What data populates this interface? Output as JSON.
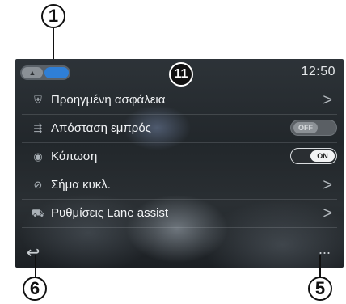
{
  "callouts": {
    "toggle": "1",
    "back": "6",
    "more": "5",
    "screen_marker": "11"
  },
  "status_bar": {
    "clock": "12:50"
  },
  "menu": {
    "items": [
      {
        "label": "Προηγμένη ασφάλεια",
        "icon": "shield-car-icon",
        "control": "chevron"
      },
      {
        "label": "Απόσταση εμπρός",
        "icon": "distance-icon",
        "control": "switch",
        "state": "OFF"
      },
      {
        "label": "Κόπωση",
        "icon": "fatigue-icon",
        "control": "switch",
        "state": "ON"
      },
      {
        "label": "Σήμα κυκλ.",
        "icon": "traffic-sign-icon",
        "control": "chevron"
      },
      {
        "label": "Ρυθμίσεις Lane assist",
        "icon": "lane-assist-icon",
        "control": "chevron"
      }
    ]
  },
  "bottom_bar": {
    "back_icon": "back-arrow-icon",
    "more_icon": "more-options-icon",
    "more_glyph": "···"
  },
  "colors": {
    "accent": "#2f7fd6"
  }
}
